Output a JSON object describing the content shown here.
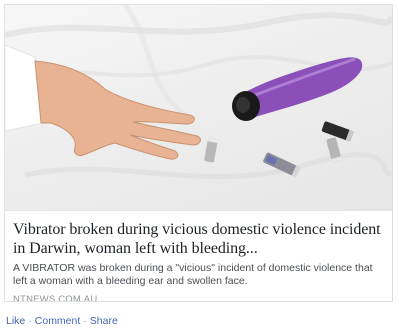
{
  "link_preview": {
    "image_alt": "Hand resting on white sheets beside a purple toy and scattered batteries",
    "headline": "Vibrator broken during vicious domestic violence incident in Darwin, woman left with bleeding...",
    "summary": "A VIBRATOR was broken during a \"vicious\" incident of domestic violence that left a woman with a bleeding ear and swollen face.",
    "source": "NTNEWS.COM.AU"
  },
  "actions": {
    "like_label": "Like",
    "comment_label": "Comment",
    "share_label": "Share",
    "separator": "·"
  },
  "colors": {
    "link_blue": "#4267b2",
    "headline_text": "#1d2129",
    "meta_gray": "#90949c",
    "toy_purple": "#8a4fb8"
  }
}
